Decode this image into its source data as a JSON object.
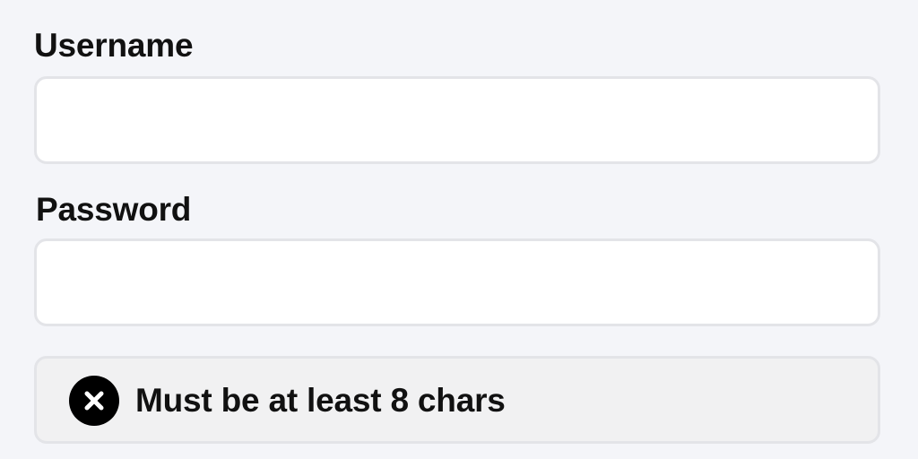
{
  "form": {
    "username": {
      "label": "Username",
      "value": "",
      "placeholder": ""
    },
    "password": {
      "label": "Password",
      "value": "",
      "placeholder": ""
    },
    "validation": {
      "icon": "x-circle-icon",
      "message": "Must be at least 8 chars",
      "status": "invalid"
    }
  },
  "colors": {
    "background": "#f4f5f9",
    "input_background": "#ffffff",
    "input_border": "#e3e4e8",
    "validation_background": "#f1f1f2",
    "icon": "#000000",
    "text": "#111111"
  }
}
